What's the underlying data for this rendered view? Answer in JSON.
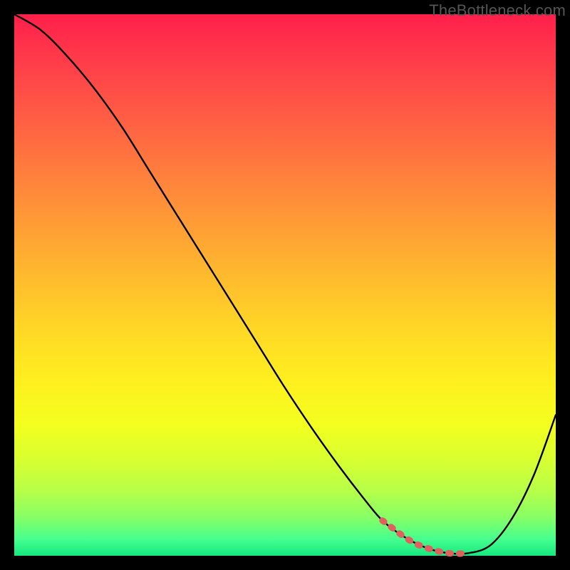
{
  "watermark": "TheBottleneck.com",
  "colors": {
    "frame": "#000000",
    "curve": "#000000",
    "highlight": "#e06060",
    "gradient_top": "#ff1f4b",
    "gradient_bottom": "#16e77f"
  },
  "chart_data": {
    "type": "line",
    "title": "",
    "xlabel": "",
    "ylabel": "",
    "xlim": [
      0,
      100
    ],
    "ylim": [
      0,
      100
    ],
    "grid": false,
    "note": "y is bottleneck magnitude (top=high, bottom=low); curve descends toward optimal then rises",
    "series": [
      {
        "name": "bottleneck-curve",
        "x": [
          0,
          5,
          10,
          15,
          20,
          25,
          30,
          35,
          40,
          45,
          50,
          55,
          60,
          65,
          68,
          72,
          76,
          80,
          84,
          88,
          92,
          96,
          100
        ],
        "values": [
          100,
          97,
          92,
          86,
          79,
          71,
          63,
          55,
          47,
          39,
          31,
          23.5,
          16.5,
          10,
          6.5,
          3.5,
          1.5,
          0.5,
          0.5,
          2,
          7,
          15,
          26
        ]
      },
      {
        "name": "optimal-highlight",
        "x": [
          68,
          70,
          72,
          74,
          76,
          78,
          80,
          82,
          84
        ],
        "values": [
          6.5,
          5.0,
          3.5,
          2.3,
          1.5,
          0.9,
          0.5,
          0.4,
          0.5
        ]
      }
    ]
  }
}
